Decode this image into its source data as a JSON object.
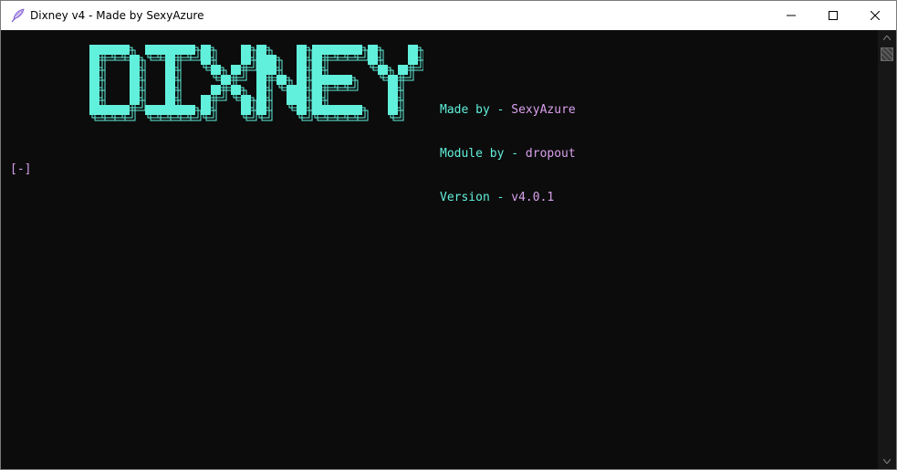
{
  "window": {
    "title": "Dixney v4 - Made by SexyAzure",
    "icon": "feather-icon"
  },
  "caption_buttons": {
    "minimize": "minimize-icon",
    "maximize": "maximize-icon",
    "close": "close-icon"
  },
  "banner": {
    "text": "DIXNEY",
    "color": "#61f0dc"
  },
  "info": {
    "made_by_label": "Made by - ",
    "made_by_value": "SexyAzure",
    "module_label": "Module by - ",
    "module_value": "dropout",
    "version_label": "Version - ",
    "version_value": "v4.0.1"
  },
  "console": {
    "prompt": "[-]",
    "background": "#0c0c0c",
    "label_color": "#61f0dc",
    "value_color": "#d9a0ec"
  }
}
